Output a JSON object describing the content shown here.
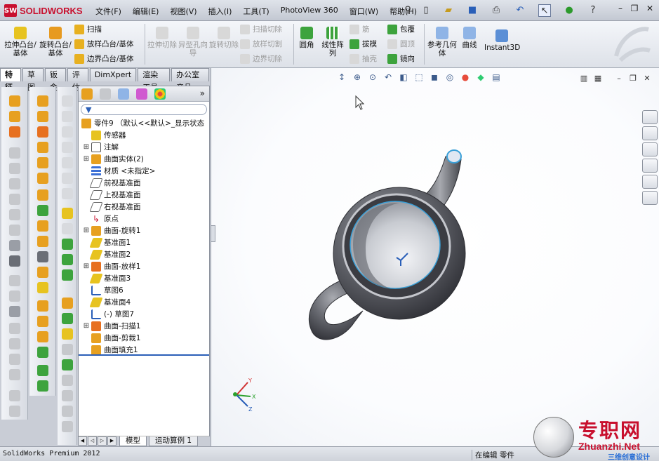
{
  "app": {
    "logo_mark": "SW",
    "logo_text": "SOLIDWORKS",
    "menu": [
      "文件(F)",
      "编辑(E)",
      "视图(V)",
      "插入(I)",
      "工具(T)",
      "PhotoView 360",
      "窗口(W)",
      "帮助(H)"
    ]
  },
  "commands": {
    "extrude_boss": "拉伸凸台/基体",
    "revolve_boss": "旋转凸台/基体",
    "sweep": "扫描",
    "loft_boss": "放样凸台/基体",
    "boundary_boss": "边界凸台/基体",
    "extrude_cut": "拉伸切除",
    "hole_wizard": "异型孔向导",
    "revolve_cut": "旋转切除",
    "sweep_cut": "扫描切除",
    "loft_cut": "放样切割",
    "boundary_cut": "边界切除",
    "fillet": "圆角",
    "linear_pattern": "线性阵列",
    "rib": "筋",
    "draft": "拔模",
    "shell": "抽壳",
    "wrap": "包覆",
    "dome": "圆顶",
    "mirror": "镜向",
    "ref_geometry": "参考几何体",
    "curves": "曲线",
    "instant3d": "Instant3D"
  },
  "tabs": [
    "特征",
    "草图",
    "钣金",
    "评估",
    "DimXpert",
    "渲染工具",
    "办公室产品"
  ],
  "active_tab": "特征",
  "feature_tree": {
    "root": "零件9 （默认<<默认>_显示状态",
    "items": [
      {
        "label": "传感器",
        "icon": "sensor-icon",
        "expandable": false
      },
      {
        "label": "注解",
        "icon": "annotation-icon",
        "expandable": true
      },
      {
        "label": "曲面实体(2)",
        "icon": "surface-bodies-icon",
        "expandable": true
      },
      {
        "label": "材质 <未指定>",
        "icon": "material-icon",
        "expandable": false
      },
      {
        "label": "前视基准面",
        "icon": "plane-icon",
        "expandable": false
      },
      {
        "label": "上视基准面",
        "icon": "plane-icon",
        "expandable": false
      },
      {
        "label": "右视基准面",
        "icon": "plane-icon",
        "expandable": false
      },
      {
        "label": "原点",
        "icon": "origin-icon",
        "expandable": false
      },
      {
        "label": "曲面-旋转1",
        "icon": "surface-revolve-icon",
        "expandable": true
      },
      {
        "label": "基准面1",
        "icon": "plane-icon",
        "expandable": false
      },
      {
        "label": "基准面2",
        "icon": "plane-icon",
        "expandable": false
      },
      {
        "label": "曲面-放样1",
        "icon": "surface-loft-icon",
        "expandable": true
      },
      {
        "label": "基准面3",
        "icon": "plane-icon",
        "expandable": false
      },
      {
        "label": "草图6",
        "icon": "sketch-icon",
        "expandable": false
      },
      {
        "label": "基准面4",
        "icon": "plane-icon",
        "expandable": false
      },
      {
        "label": "(-) 草图7",
        "icon": "sketch-icon",
        "expandable": false
      },
      {
        "label": "曲面-扫描1",
        "icon": "surface-sweep-icon",
        "expandable": true
      },
      {
        "label": "曲面-剪栽1",
        "icon": "surface-trim-icon",
        "expandable": false
      },
      {
        "label": "曲面填充1",
        "icon": "surface-fill-icon",
        "expandable": false
      }
    ]
  },
  "bottom_tabs": [
    "模型",
    "运动算例 1"
  ],
  "status": {
    "product": "SolidWorks Premium 2012",
    "editing": "在编辑 零件"
  },
  "watermark": {
    "brand": "专职网",
    "url": "Zhuanzhi.Net",
    "sub": "三维创意设计"
  },
  "colors": {
    "accent": "#c8102e",
    "selection_blue": "#2a5fb8",
    "model_body": "#5e6067"
  }
}
